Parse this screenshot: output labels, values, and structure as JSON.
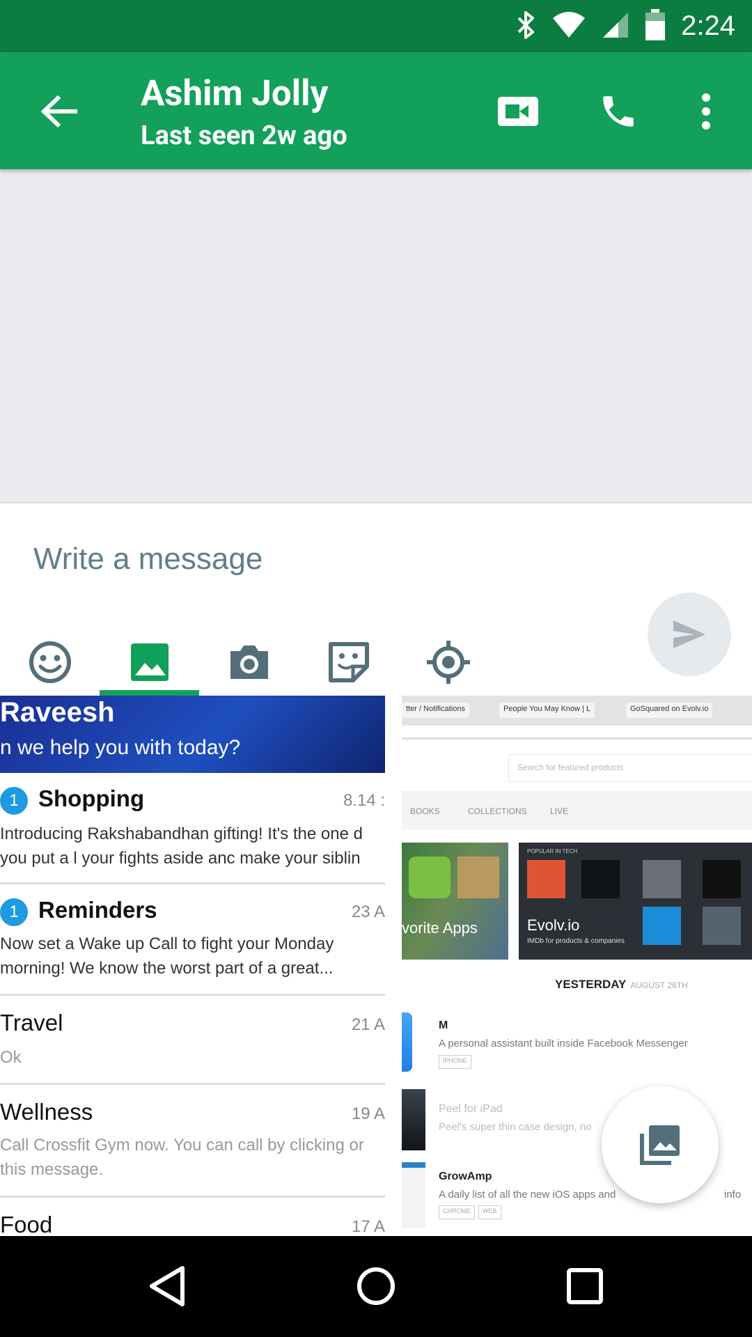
{
  "status_bar": {
    "time": "2:24",
    "icons": [
      "bluetooth-icon",
      "wifi-icon",
      "cell-signal-icon",
      "battery-icon"
    ]
  },
  "app_bar": {
    "title": "Ashim Jolly",
    "subtitle": "Last seen 2w ago",
    "actions": [
      "back-arrow-icon",
      "video-call-icon",
      "phone-call-icon",
      "more-vert-icon"
    ]
  },
  "composer": {
    "placeholder": "Write a message",
    "tabs": [
      {
        "icon": "emoji-icon",
        "active": false
      },
      {
        "icon": "gallery-icon",
        "active": true
      },
      {
        "icon": "camera-icon",
        "active": false
      },
      {
        "icon": "sticker-icon",
        "active": false
      },
      {
        "icon": "location-icon",
        "active": false
      }
    ]
  },
  "gallery": {
    "left_screenshot": {
      "header_name": "Raveesh",
      "header_sub": "n we help you with today?",
      "rows": [
        {
          "title": "Shopping",
          "bold": true,
          "badge": "1",
          "date": "8.14 :",
          "body": [
            "Introducing Rakshabandhan gifting! It's the one d",
            "you put a l your fights aside anc make your siblin"
          ]
        },
        {
          "title": "Reminders",
          "bold": true,
          "badge": "1",
          "date": "23 A",
          "body": [
            "Now set a Wake up Call to fight your Monday",
            "morning! We know the worst part of a great..."
          ]
        },
        {
          "title": "Travel",
          "bold": false,
          "badge": "",
          "date": "21 A",
          "body": [
            "Ok"
          ]
        },
        {
          "title": "Wellness",
          "bold": false,
          "badge": "",
          "date": "19 A",
          "body": [
            "Call Crossfit Gym now. You can call by clicking or",
            "this message."
          ]
        },
        {
          "title": "Food",
          "bold": false,
          "badge": "",
          "date": "17 A",
          "body": []
        }
      ]
    },
    "right_screenshot": {
      "browser_tabs": [
        "tter / Notifications",
        "People You May Know | L",
        "GoSquared on Evolv.io"
      ],
      "search_placeholder": "Search for featured products",
      "nav_items": [
        "BOOKS",
        "COLLECTIONS",
        "LIVE"
      ],
      "card_left_label": "vorite Apps",
      "card_right_label": "Evolv.io",
      "card_right_sub": "IMDb for products & companies",
      "card_right_tag": "POPULAR IN TECH",
      "yesterday_label": "YESTERDAY",
      "yesterday_date": "AUGUST 26TH",
      "items": [
        {
          "title": "M",
          "desc": "A personal assistant built inside Facebook Messenger",
          "tags": [
            "IPHONE"
          ],
          "faded": false
        },
        {
          "title": "Peel for iPad",
          "desc": "Peel's super thin case design, no",
          "tags": [],
          "faded": true
        },
        {
          "title": "GrowAmp",
          "desc": "A daily list of all the new iOS apps and",
          "tags": [
            "CHROME",
            "WEB"
          ],
          "faded": false
        }
      ],
      "desc_tail": "info"
    }
  },
  "nav_bar": {
    "buttons": [
      "back-triangle-icon",
      "home-circle-icon",
      "recents-square-icon"
    ]
  },
  "colors": {
    "status_bar": "#0c7d40",
    "app_bar": "#13a05a",
    "accent": "#13a05a",
    "icon_grey": "#546e7a",
    "placeholder": "#607d8b"
  }
}
